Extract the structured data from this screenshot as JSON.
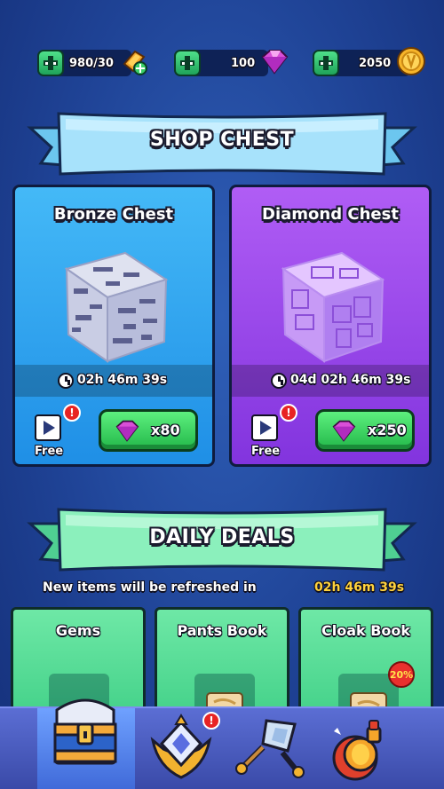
{
  "resources": {
    "energy": {
      "value": "980/30",
      "icon": "energy-icon"
    },
    "gems": {
      "value": "100",
      "icon": "gem-icon"
    },
    "coins": {
      "value": "2050",
      "icon": "coin-icon"
    }
  },
  "shop": {
    "title": "SHOP CHEST",
    "chests": [
      {
        "name": "Bronze Chest",
        "timer": "02h 46m 39s",
        "free_label": "Free",
        "price": "x80",
        "alert": "!"
      },
      {
        "name": "Diamond Chest",
        "timer": "04d 02h 46m 39s",
        "free_label": "Free",
        "price": "x250",
        "alert": "!"
      }
    ]
  },
  "daily_deals": {
    "title": "DAILY DEALS",
    "refresh_text": "New items will be refreshed in",
    "refresh_time": "02h 46m 39s",
    "items": [
      {
        "title": "Gems"
      },
      {
        "title": "Pants Book"
      },
      {
        "title": "Cloak Book",
        "discount": "20%"
      }
    ]
  },
  "bottom_nav": {
    "tabs": [
      {
        "icon": "chest-icon",
        "active": true
      },
      {
        "icon": "rank-emblem-icon",
        "alert": "!"
      },
      {
        "icon": "weapons-icon"
      },
      {
        "icon": "potion-icon"
      }
    ]
  },
  "colors": {
    "background": "#2a57b0",
    "bronze_card": "#2f9ef0",
    "diamond_card": "#9a48ea",
    "deal_card": "#56dd96",
    "buy_button": "#3fd464",
    "timer_highlight": "#ffd23c",
    "ribbon_blue": "#a7e2fb",
    "ribbon_green": "#8bf0bc"
  }
}
